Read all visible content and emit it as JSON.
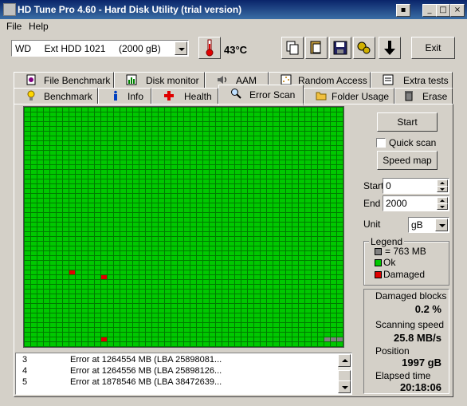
{
  "window": {
    "title": "HD Tune Pro 4.60 - Hard Disk Utility (trial version)"
  },
  "menu": {
    "file": "File",
    "help": "Help"
  },
  "toolbar": {
    "drive_label": "WD     Ext HDD 1021     (2000 gB)",
    "temperature": "43°C",
    "exit_label": "Exit"
  },
  "tabs_top": [
    "File Benchmark",
    "Disk monitor",
    "AAM",
    "Random Access",
    "Extra tests"
  ],
  "tabs_bottom": [
    "Benchmark",
    "Info",
    "Health",
    "Error Scan",
    "Folder Usage",
    "Erase"
  ],
  "active_tab": "Error Scan",
  "controls": {
    "start_label": "Start",
    "quick_scan_label": "Quick scan",
    "quick_scan_checked": false,
    "speed_map_label": "Speed map",
    "start_field_label": "Start",
    "start_value": "0",
    "end_field_label": "End",
    "end_value": "2000",
    "unit_label": "Unit",
    "unit_value": "gB"
  },
  "legend": {
    "title": "Legend",
    "block_size": "= 763 MB",
    "ok_label": "Ok",
    "damaged_label": "Damaged",
    "colors": {
      "unscanned": "#808080",
      "ok": "#00c800",
      "damaged": "#e00000"
    }
  },
  "stats": {
    "damaged_blocks_label": "Damaged blocks",
    "damaged_blocks_value": "0.2 %",
    "scanning_speed_label": "Scanning speed",
    "scanning_speed_value": "25.8 MB/s",
    "position_label": "Position",
    "position_value": "1997 gB",
    "elapsed_label": "Elapsed time",
    "elapsed_value": "20:18:06"
  },
  "log": [
    {
      "no": "3",
      "text": "Error at 1264554 MB (LBA 25898081..."
    },
    {
      "no": "4",
      "text": "Error at 1264556 MB (LBA 25898126..."
    },
    {
      "no": "5",
      "text": "Error at 1878546 MB (LBA 38472639..."
    }
  ],
  "scan_map": {
    "columns": 50,
    "rows": 50,
    "damaged_cells": [
      [
        34,
        7
      ],
      [
        35,
        12
      ],
      [
        48,
        12
      ]
    ],
    "unscanned_cells": [
      [
        48,
        47
      ],
      [
        48,
        48
      ],
      [
        48,
        49
      ]
    ]
  }
}
